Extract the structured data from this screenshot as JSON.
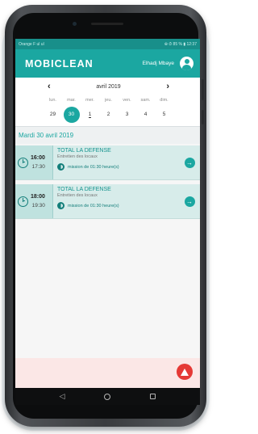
{
  "status_bar": {
    "left": "Orange F  ul  ul",
    "right": "⊕ ⏱ 85 % ▮ 12:37"
  },
  "app": {
    "title": "MOBICLEAN",
    "user_name": "Elhadj Mbaye",
    "avatar_icon": "user-avatar-icon"
  },
  "calendar": {
    "month": "avril 2019",
    "prev_icon": "chevron-left-icon",
    "next_icon": "chevron-right-icon",
    "weekdays": [
      "lun.",
      "mar.",
      "mer.",
      "jeu.",
      "ven.",
      "sam.",
      "dim."
    ],
    "dates": [
      "29",
      "30",
      "1",
      "2",
      "3",
      "4",
      "5"
    ],
    "selected_index": 1,
    "underlined_index": 2
  },
  "day_header": "Mardi 30 avril 2019",
  "missions": [
    {
      "start": "16:00",
      "end": "17:30",
      "client": "TOTAL LA DEFENSE",
      "service": "Entretien des locaux",
      "duration": "mission de 01:30 heure(s)"
    },
    {
      "start": "18:00",
      "end": "19:30",
      "client": "TOTAL LA DEFENSE",
      "service": "Entretien des locaux",
      "duration": "mission de 01:30 heure(s)"
    }
  ],
  "colors": {
    "primary": "#1ba7a1",
    "status_bar": "#188f8a",
    "mission_bg": "#d7ecea",
    "alert": "#e53935"
  },
  "alert_icon": "warning-triangle-icon",
  "nav": {
    "back": "◁",
    "home_icon": "circle-home-icon",
    "recent_icon": "square-recent-icon"
  }
}
